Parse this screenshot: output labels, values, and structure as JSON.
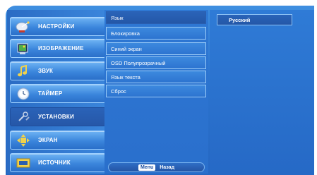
{
  "sidebar": {
    "items": [
      {
        "label": "НАСТРОЙКИ",
        "icon": "satellite-dish-icon"
      },
      {
        "label": "ИЗОБРАЖЕНИЕ",
        "icon": "picture-icon"
      },
      {
        "label": "ЗВУК",
        "icon": "music-note-icon"
      },
      {
        "label": "ТАЙМЕР",
        "icon": "clock-icon"
      },
      {
        "label": "УСТАНОВКИ",
        "icon": "settings-tools-icon"
      },
      {
        "label": "ЭКРАН",
        "icon": "screen-arrows-icon"
      },
      {
        "label": "ИСТОЧНИК",
        "icon": "source-input-icon"
      }
    ],
    "active_index": 4
  },
  "submenu": {
    "items": [
      {
        "label": "Язык"
      },
      {
        "label": "Блокировка"
      },
      {
        "label": "Синий экран"
      },
      {
        "label": "OSD Полупрозрачный"
      },
      {
        "label": "Язык текста"
      },
      {
        "label": "Сброс"
      }
    ],
    "selected_index": 0
  },
  "options": {
    "value": "Русский"
  },
  "footer": {
    "key": "Menu",
    "action": "Назад"
  },
  "colors": {
    "background": "#2b74cf",
    "accent_light": "#6fb4f4",
    "selected": "#2457a7",
    "text": "#ffffff"
  }
}
